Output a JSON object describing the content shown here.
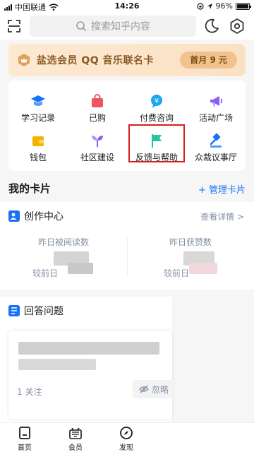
{
  "status_bar": {
    "carrier": "中国联通",
    "time": "14:26",
    "battery": "96%"
  },
  "search": {
    "placeholder": "搜索知乎内容"
  },
  "vip_banner": {
    "text": "盐选会员 QQ 音乐联名卡",
    "price_label": "首月 9 元"
  },
  "grid": {
    "items": [
      {
        "label": "学习记录",
        "icon": "graduation-cap-icon",
        "color": "#1772f6"
      },
      {
        "label": "已购",
        "icon": "shopping-bag-icon",
        "color": "#f0555e"
      },
      {
        "label": "付费咨询",
        "icon": "yuan-chat-icon",
        "color": "#1aa6f2"
      },
      {
        "label": "活动广场",
        "icon": "megaphone-icon",
        "color": "#8a5cf2"
      },
      {
        "label": "钱包",
        "icon": "wallet-icon",
        "color": "#f5b300"
      },
      {
        "label": "社区建设",
        "icon": "sprout-icon",
        "color": "#8a5cf2"
      },
      {
        "label": "反馈与帮助",
        "icon": "flag-icon",
        "color": "#27c4a0"
      },
      {
        "label": "众裁议事厅",
        "icon": "gavel-icon",
        "color": "#1772f6"
      }
    ]
  },
  "my_cards": {
    "title": "我的卡片",
    "manage_label": "+ 管理卡片"
  },
  "creation_center": {
    "title": "创作中心",
    "detail_label": "查看详情 >",
    "stats": [
      {
        "label": "昨日被阅读数",
        "compare_label": "较前日"
      },
      {
        "label": "昨日获赞数",
        "compare_label": "较前日"
      }
    ]
  },
  "answer_question": {
    "title": "回答问题",
    "follow_count": "1 关注",
    "ignore_label": "忽略"
  },
  "tabbar": {
    "tabs": [
      {
        "label": "首页",
        "icon": "home-icon"
      },
      {
        "label": "会员",
        "icon": "vip-icon"
      },
      {
        "label": "发现",
        "icon": "compass-icon"
      }
    ]
  },
  "colors": {
    "accent": "#1772f6",
    "highlight_box": "#d42020",
    "vip_text": "#8a5a22"
  }
}
